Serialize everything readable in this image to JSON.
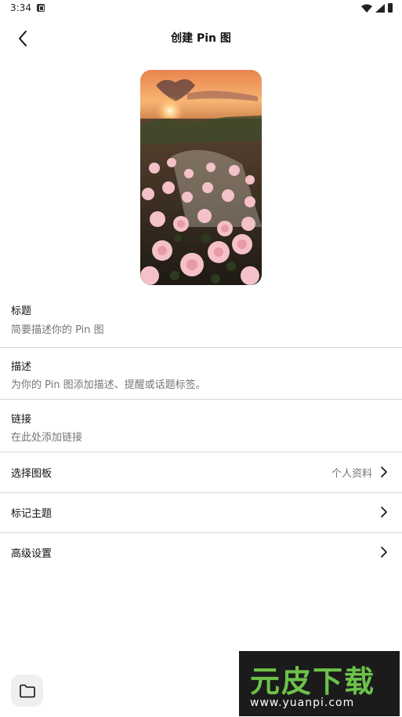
{
  "status_bar": {
    "time": "3:34"
  },
  "header": {
    "title": "创建 Pin 图"
  },
  "fields": {
    "title": {
      "label": "标题",
      "placeholder": "简要描述你的 Pin 图"
    },
    "description": {
      "label": "描述",
      "placeholder": "为你的 Pin 图添加描述、提醒或话题标签。"
    },
    "link": {
      "label": "链接",
      "placeholder": "在此处添加链接"
    }
  },
  "rows": {
    "board": {
      "label": "选择图板",
      "value": "个人资料"
    },
    "tag_topics": {
      "label": "标记主题"
    },
    "advanced": {
      "label": "高级设置"
    }
  },
  "watermark": {
    "text": "元皮下载",
    "url": "www.yuanpi.com"
  },
  "icons": {
    "back": "back-arrow-icon",
    "chevron": "chevron-right-icon",
    "folder": "folder-icon"
  }
}
